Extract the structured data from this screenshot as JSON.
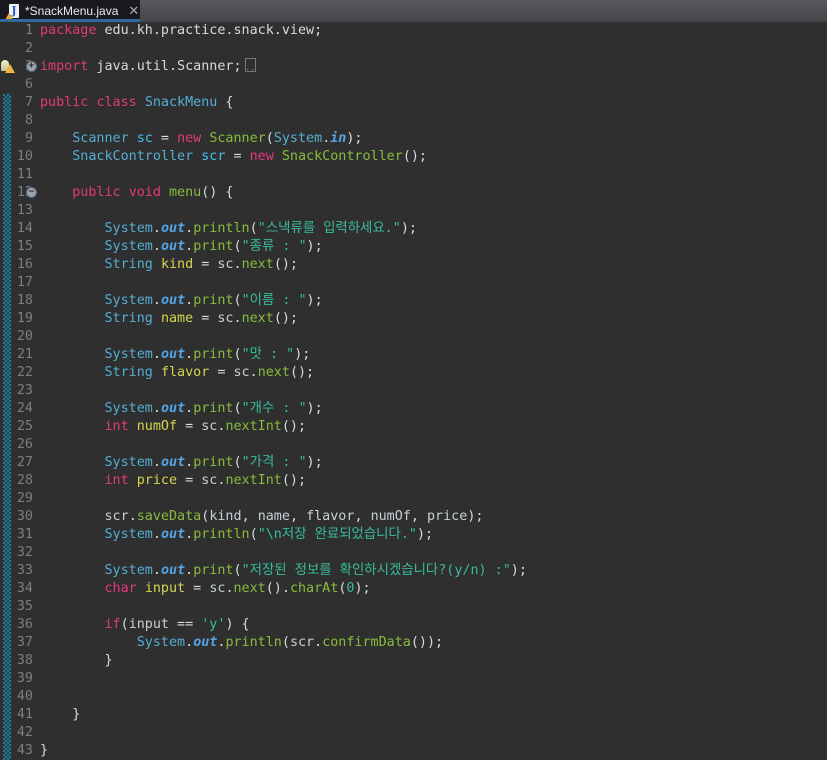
{
  "tab_bar": {
    "tabs": [
      {
        "title": "*SnackMenu.java",
        "modified": true,
        "active": true,
        "icon_letter": "J",
        "close_glyph": "✕"
      }
    ]
  },
  "icons": {
    "tab_file": "java-file-icon with warning overlay",
    "gutter_warning": "warning-quickfix-icon (lightbulb + triangle)",
    "fold_collapsed_glyph": "+",
    "fold_expanded_glyph": "−",
    "folded_region_dots": "··"
  },
  "colors": {
    "editor_bg": "#2F2F2F",
    "tab_bar_top": "#56585C",
    "tab_bar_bottom": "#434549",
    "active_tab_bg": "#17191E",
    "tab_accent_underline": "#33689F",
    "line_number": "#7B7E82",
    "quickdiff_teal": "#2B7795",
    "keyword": "#E5397B",
    "class_type": "#54AED3",
    "method": "#87BC3C",
    "string": "#38BD9C",
    "field_declaration": "#43C2EF",
    "static_field": "#55A4E6",
    "local_var_declaration": "#D3D54F",
    "default_text": "#D8DADA"
  },
  "editor": {
    "quickdiff_lines": "7-43",
    "rows": [
      {
        "n": "1",
        "t": [
          [
            "kw",
            "package"
          ],
          [
            "pl",
            " edu.kh.practice.snack.view;"
          ]
        ]
      },
      {
        "n": "2",
        "t": []
      },
      {
        "n": "3",
        "fold": "+",
        "warn": true,
        "foldbox": true,
        "t": [
          [
            "kw",
            "import"
          ],
          [
            "pl",
            " java.util.Scanner;"
          ]
        ]
      },
      {
        "n": "6",
        "t": []
      },
      {
        "n": "7",
        "t": [
          [
            "kw",
            "public"
          ],
          [
            "pl",
            " "
          ],
          [
            "kw",
            "class"
          ],
          [
            "pl",
            " "
          ],
          [
            "cls",
            "SnackMenu"
          ],
          [
            "pl",
            " {"
          ]
        ]
      },
      {
        "n": "8",
        "t": []
      },
      {
        "n": "9",
        "t": [
          [
            "pl",
            "    "
          ],
          [
            "cls",
            "Scanner"
          ],
          [
            "pl",
            " "
          ],
          [
            "fld",
            "sc"
          ],
          [
            "pl",
            " = "
          ],
          [
            "kw",
            "new"
          ],
          [
            "pl",
            " "
          ],
          [
            "mth",
            "Scanner"
          ],
          [
            "pl",
            "("
          ],
          [
            "cls",
            "System"
          ],
          [
            "pl",
            "."
          ],
          [
            "sfld",
            "in"
          ],
          [
            "pl",
            ");"
          ]
        ]
      },
      {
        "n": "10",
        "t": [
          [
            "pl",
            "    "
          ],
          [
            "cls",
            "SnackController"
          ],
          [
            "pl",
            " "
          ],
          [
            "fld",
            "scr"
          ],
          [
            "pl",
            " = "
          ],
          [
            "kw",
            "new"
          ],
          [
            "pl",
            " "
          ],
          [
            "mth",
            "SnackController"
          ],
          [
            "pl",
            "();"
          ]
        ]
      },
      {
        "n": "11",
        "t": []
      },
      {
        "n": "12",
        "fold": "−",
        "t": [
          [
            "pl",
            "    "
          ],
          [
            "kw",
            "public"
          ],
          [
            "pl",
            " "
          ],
          [
            "kw",
            "void"
          ],
          [
            "pl",
            " "
          ],
          [
            "mth",
            "menu"
          ],
          [
            "pl",
            "() {"
          ]
        ]
      },
      {
        "n": "13",
        "t": []
      },
      {
        "n": "14",
        "t": [
          [
            "pl",
            "        "
          ],
          [
            "cls",
            "System"
          ],
          [
            "pl",
            "."
          ],
          [
            "sfld",
            "out"
          ],
          [
            "pl",
            "."
          ],
          [
            "mth",
            "println"
          ],
          [
            "pl",
            "("
          ],
          [
            "str",
            "\"스낵류를 입력하세요.\""
          ],
          [
            "pl",
            ");"
          ]
        ]
      },
      {
        "n": "15",
        "t": [
          [
            "pl",
            "        "
          ],
          [
            "cls",
            "System"
          ],
          [
            "pl",
            "."
          ],
          [
            "sfld",
            "out"
          ],
          [
            "pl",
            "."
          ],
          [
            "mth",
            "print"
          ],
          [
            "pl",
            "("
          ],
          [
            "str",
            "\"종류 : \""
          ],
          [
            "pl",
            ");"
          ]
        ]
      },
      {
        "n": "16",
        "t": [
          [
            "pl",
            "        "
          ],
          [
            "cls",
            "String"
          ],
          [
            "pl",
            " "
          ],
          [
            "var",
            "kind"
          ],
          [
            "pl",
            " = "
          ],
          [
            "ref",
            "sc"
          ],
          [
            "pl",
            "."
          ],
          [
            "mth",
            "next"
          ],
          [
            "pl",
            "();"
          ]
        ]
      },
      {
        "n": "17",
        "t": []
      },
      {
        "n": "18",
        "t": [
          [
            "pl",
            "        "
          ],
          [
            "cls",
            "System"
          ],
          [
            "pl",
            "."
          ],
          [
            "sfld",
            "out"
          ],
          [
            "pl",
            "."
          ],
          [
            "mth",
            "print"
          ],
          [
            "pl",
            "("
          ],
          [
            "str",
            "\"이름 : \""
          ],
          [
            "pl",
            ");"
          ]
        ]
      },
      {
        "n": "19",
        "t": [
          [
            "pl",
            "        "
          ],
          [
            "cls",
            "String"
          ],
          [
            "pl",
            " "
          ],
          [
            "var",
            "name"
          ],
          [
            "pl",
            " = "
          ],
          [
            "ref",
            "sc"
          ],
          [
            "pl",
            "."
          ],
          [
            "mth",
            "next"
          ],
          [
            "pl",
            "();"
          ]
        ]
      },
      {
        "n": "20",
        "t": []
      },
      {
        "n": "21",
        "t": [
          [
            "pl",
            "        "
          ],
          [
            "cls",
            "System"
          ],
          [
            "pl",
            "."
          ],
          [
            "sfld",
            "out"
          ],
          [
            "pl",
            "."
          ],
          [
            "mth",
            "print"
          ],
          [
            "pl",
            "("
          ],
          [
            "str",
            "\"맛 : \""
          ],
          [
            "pl",
            ");"
          ]
        ]
      },
      {
        "n": "22",
        "t": [
          [
            "pl",
            "        "
          ],
          [
            "cls",
            "String"
          ],
          [
            "pl",
            " "
          ],
          [
            "var",
            "flavor"
          ],
          [
            "pl",
            " = "
          ],
          [
            "ref",
            "sc"
          ],
          [
            "pl",
            "."
          ],
          [
            "mth",
            "next"
          ],
          [
            "pl",
            "();"
          ]
        ]
      },
      {
        "n": "23",
        "t": []
      },
      {
        "n": "24",
        "t": [
          [
            "pl",
            "        "
          ],
          [
            "cls",
            "System"
          ],
          [
            "pl",
            "."
          ],
          [
            "sfld",
            "out"
          ],
          [
            "pl",
            "."
          ],
          [
            "mth",
            "print"
          ],
          [
            "pl",
            "("
          ],
          [
            "str",
            "\"개수 : \""
          ],
          [
            "pl",
            ");"
          ]
        ]
      },
      {
        "n": "25",
        "t": [
          [
            "pl",
            "        "
          ],
          [
            "kw",
            "int"
          ],
          [
            "pl",
            " "
          ],
          [
            "var",
            "numOf"
          ],
          [
            "pl",
            " = "
          ],
          [
            "ref",
            "sc"
          ],
          [
            "pl",
            "."
          ],
          [
            "mth",
            "nextInt"
          ],
          [
            "pl",
            "();"
          ]
        ]
      },
      {
        "n": "26",
        "t": []
      },
      {
        "n": "27",
        "t": [
          [
            "pl",
            "        "
          ],
          [
            "cls",
            "System"
          ],
          [
            "pl",
            "."
          ],
          [
            "sfld",
            "out"
          ],
          [
            "pl",
            "."
          ],
          [
            "mth",
            "print"
          ],
          [
            "pl",
            "("
          ],
          [
            "str",
            "\"가격 : \""
          ],
          [
            "pl",
            ");"
          ]
        ]
      },
      {
        "n": "28",
        "t": [
          [
            "pl",
            "        "
          ],
          [
            "kw",
            "int"
          ],
          [
            "pl",
            " "
          ],
          [
            "var",
            "price"
          ],
          [
            "pl",
            " = "
          ],
          [
            "ref",
            "sc"
          ],
          [
            "pl",
            "."
          ],
          [
            "mth",
            "nextInt"
          ],
          [
            "pl",
            "();"
          ]
        ]
      },
      {
        "n": "29",
        "t": []
      },
      {
        "n": "30",
        "t": [
          [
            "pl",
            "        "
          ],
          [
            "ref",
            "scr"
          ],
          [
            "pl",
            "."
          ],
          [
            "mth",
            "saveData"
          ],
          [
            "pl",
            "("
          ],
          [
            "ref",
            "kind"
          ],
          [
            "pl",
            ", "
          ],
          [
            "ref",
            "name"
          ],
          [
            "pl",
            ", "
          ],
          [
            "ref",
            "flavor"
          ],
          [
            "pl",
            ", "
          ],
          [
            "ref",
            "numOf"
          ],
          [
            "pl",
            ", "
          ],
          [
            "ref",
            "price"
          ],
          [
            "pl",
            ");"
          ]
        ]
      },
      {
        "n": "31",
        "t": [
          [
            "pl",
            "        "
          ],
          [
            "cls",
            "System"
          ],
          [
            "pl",
            "."
          ],
          [
            "sfld",
            "out"
          ],
          [
            "pl",
            "."
          ],
          [
            "mth",
            "println"
          ],
          [
            "pl",
            "("
          ],
          [
            "str",
            "\"\\n저장 완료되었습니다.\""
          ],
          [
            "pl",
            ");"
          ]
        ]
      },
      {
        "n": "32",
        "t": []
      },
      {
        "n": "33",
        "t": [
          [
            "pl",
            "        "
          ],
          [
            "cls",
            "System"
          ],
          [
            "pl",
            "."
          ],
          [
            "sfld",
            "out"
          ],
          [
            "pl",
            "."
          ],
          [
            "mth",
            "print"
          ],
          [
            "pl",
            "("
          ],
          [
            "str",
            "\"저장된 정보를 확인하시겠습니다?(y/n) :\""
          ],
          [
            "pl",
            ");"
          ]
        ]
      },
      {
        "n": "34",
        "t": [
          [
            "pl",
            "        "
          ],
          [
            "kw",
            "char"
          ],
          [
            "pl",
            " "
          ],
          [
            "var",
            "input"
          ],
          [
            "pl",
            " = "
          ],
          [
            "ref",
            "sc"
          ],
          [
            "pl",
            "."
          ],
          [
            "mth",
            "next"
          ],
          [
            "pl",
            "()."
          ],
          [
            "mth",
            "charAt"
          ],
          [
            "pl",
            "("
          ],
          [
            "num",
            "0"
          ],
          [
            "pl",
            ");"
          ]
        ]
      },
      {
        "n": "35",
        "t": []
      },
      {
        "n": "36",
        "t": [
          [
            "pl",
            "        "
          ],
          [
            "kw",
            "if"
          ],
          [
            "pl",
            "("
          ],
          [
            "ref",
            "input"
          ],
          [
            "pl",
            " == "
          ],
          [
            "str",
            "'y'"
          ],
          [
            "pl",
            ") {"
          ]
        ]
      },
      {
        "n": "37",
        "t": [
          [
            "pl",
            "            "
          ],
          [
            "cls",
            "System"
          ],
          [
            "pl",
            "."
          ],
          [
            "sfld",
            "out"
          ],
          [
            "pl",
            "."
          ],
          [
            "mth",
            "println"
          ],
          [
            "pl",
            "("
          ],
          [
            "ref",
            "scr"
          ],
          [
            "pl",
            "."
          ],
          [
            "mth",
            "confirmData"
          ],
          [
            "pl",
            "());"
          ]
        ]
      },
      {
        "n": "38",
        "t": [
          [
            "pl",
            "        }"
          ]
        ]
      },
      {
        "n": "39",
        "t": []
      },
      {
        "n": "40",
        "t": []
      },
      {
        "n": "41",
        "t": [
          [
            "pl",
            "    }"
          ]
        ]
      },
      {
        "n": "42",
        "t": []
      },
      {
        "n": "43",
        "t": [
          [
            "pl",
            "}"
          ]
        ]
      }
    ]
  }
}
